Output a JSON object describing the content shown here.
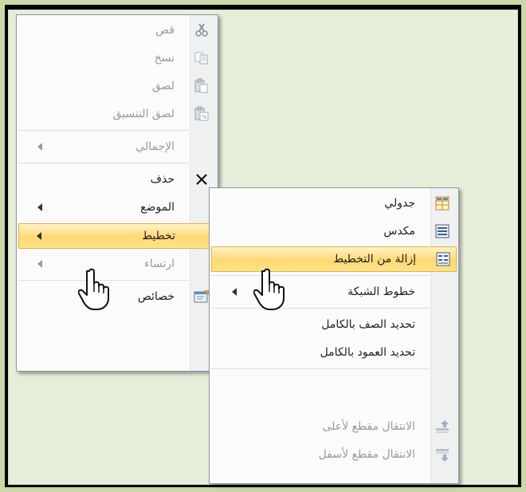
{
  "left_menu": {
    "items": [
      {
        "label": "قص",
        "enabled": false,
        "icon": "scissors-icon"
      },
      {
        "label": "نسخ",
        "enabled": false,
        "icon": "copy-icon"
      },
      {
        "label": "لصق",
        "enabled": false,
        "icon": "paste-icon"
      },
      {
        "label": "لصق التنسيق",
        "enabled": false,
        "icon": "paste-formatting-icon"
      },
      {
        "label": "الإجمالي",
        "enabled": false,
        "submenu": true
      },
      {
        "label": "حذف",
        "enabled": true,
        "icon": "delete-x-icon"
      },
      {
        "label": "الموضع",
        "enabled": true,
        "submenu": true
      },
      {
        "label": "تخطيط",
        "enabled": true,
        "submenu": true,
        "highlighted": true
      },
      {
        "label": "ارتساء",
        "enabled": false,
        "submenu": true
      },
      {
        "label": "خصائص",
        "enabled": true,
        "icon": "properties-icon"
      }
    ]
  },
  "right_menu": {
    "items": [
      {
        "label": "جدولي",
        "enabled": true,
        "icon": "tabular-layout-icon"
      },
      {
        "label": "مكدس",
        "enabled": true,
        "icon": "stacked-layout-icon"
      },
      {
        "label": "إزالة من التخطيط",
        "enabled": true,
        "icon": "remove-layout-icon",
        "highlighted": true
      },
      {
        "label": "خطوط الشبكة",
        "enabled": true,
        "submenu": true
      },
      {
        "label": "تحديد الصف بالكامل",
        "enabled": true
      },
      {
        "label": "تحديد العمود بالكامل",
        "enabled": true
      },
      {
        "label": "الانتقال مقطع لأعلى",
        "enabled": false,
        "icon": "move-up-icon"
      },
      {
        "label": "الانتقال مقطع لأسفل",
        "enabled": false,
        "icon": "move-down-icon"
      }
    ]
  },
  "colors": {
    "highlight": "#ffd873",
    "background": "#e6edd9",
    "border": "#c9d8a6"
  }
}
